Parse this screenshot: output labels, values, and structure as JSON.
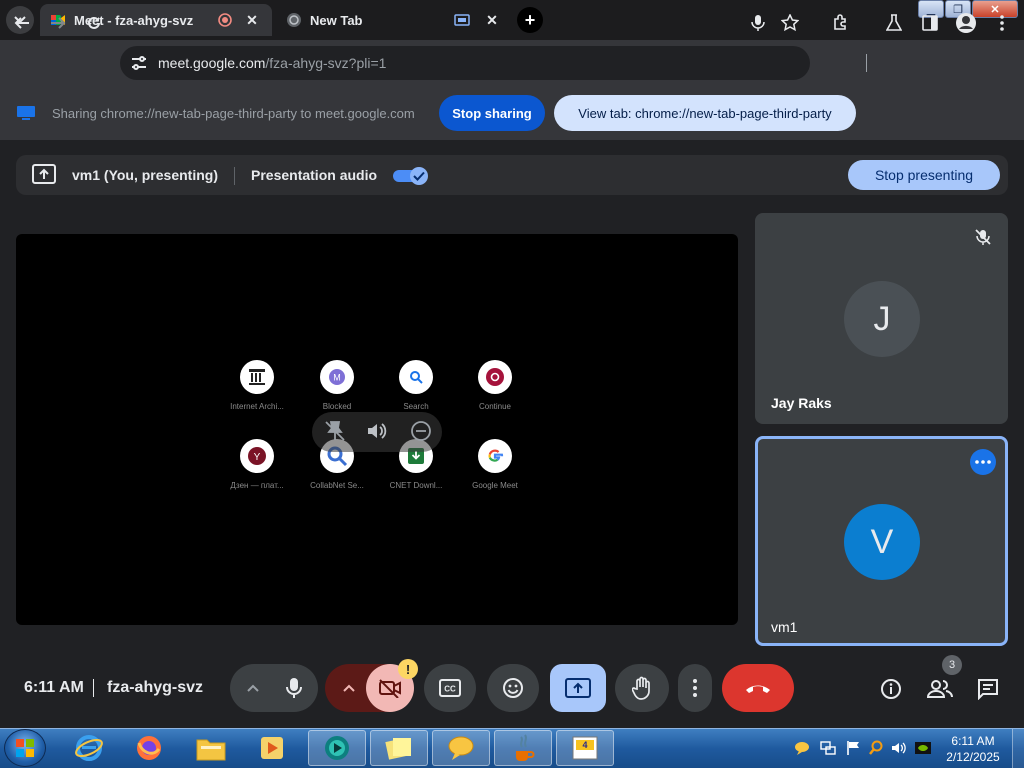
{
  "browser": {
    "tabs": [
      {
        "title": "Meet - fza-ahyg-svz",
        "close": "✕"
      },
      {
        "title": "New Tab",
        "close": "✕"
      }
    ],
    "url_host": "meet.google.com",
    "url_path": "/fza-ahyg-svz?pli=1"
  },
  "sharing_bar": {
    "text": "Sharing chrome://new-tab-page-third-party to meet.google.com",
    "stop_label": "Stop sharing",
    "view_label": "View tab: chrome://new-tab-page-third-party"
  },
  "presenting_bar": {
    "name": "vm1 (You, presenting)",
    "audio_label": "Presentation audio",
    "audio_on": true,
    "stop_label": "Stop presenting"
  },
  "shared_tab": {
    "shortcuts": [
      {
        "label": "Internet Archi...",
        "icon": "archive-icon"
      },
      {
        "label": "Blocked",
        "icon": "m-icon"
      },
      {
        "label": "Search",
        "icon": "search-icon"
      },
      {
        "label": "Continue",
        "icon": "o-icon"
      },
      {
        "label": "Дзен — плат...",
        "icon": "y-icon"
      },
      {
        "label": "CollabNet Se...",
        "icon": "search-icon"
      },
      {
        "label": "CNET Downl...",
        "icon": "download-icon"
      },
      {
        "label": "Google Meet",
        "icon": "google-icon"
      }
    ]
  },
  "participants": [
    {
      "initial": "J",
      "name": "Jay Raks",
      "color": "#3c4043",
      "muted": true
    },
    {
      "initial": "V",
      "name": "vm1",
      "color": "#0b7ed0"
    }
  ],
  "bottom_bar": {
    "time": "6:11 AM",
    "meeting_code": "fza-ahyg-svz",
    "people_count": "3",
    "camera_warning": "!"
  },
  "taskbar": {
    "time": "6:11 AM",
    "date": "2/12/2025"
  }
}
